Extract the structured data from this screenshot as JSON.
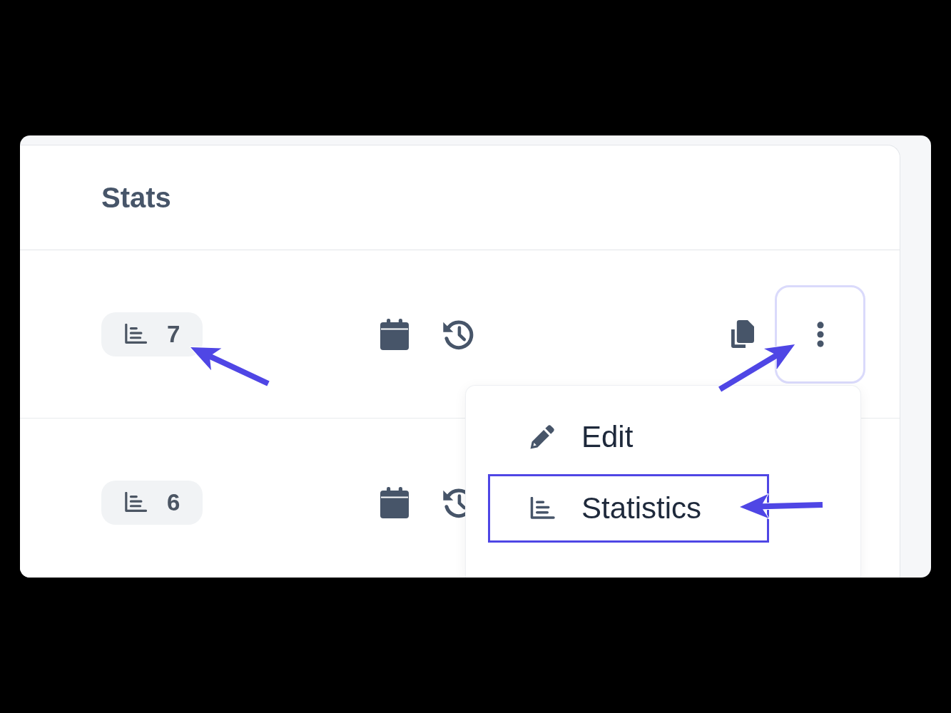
{
  "panel": {
    "title": "Stats"
  },
  "rows": [
    {
      "count": "7",
      "more_button": {
        "focused": true
      }
    },
    {
      "count": "6"
    }
  ],
  "menu": {
    "items": [
      {
        "kind": "edit",
        "label": "Edit",
        "selected": false
      },
      {
        "kind": "statistics",
        "label": "Statistics",
        "selected": true
      }
    ]
  }
}
